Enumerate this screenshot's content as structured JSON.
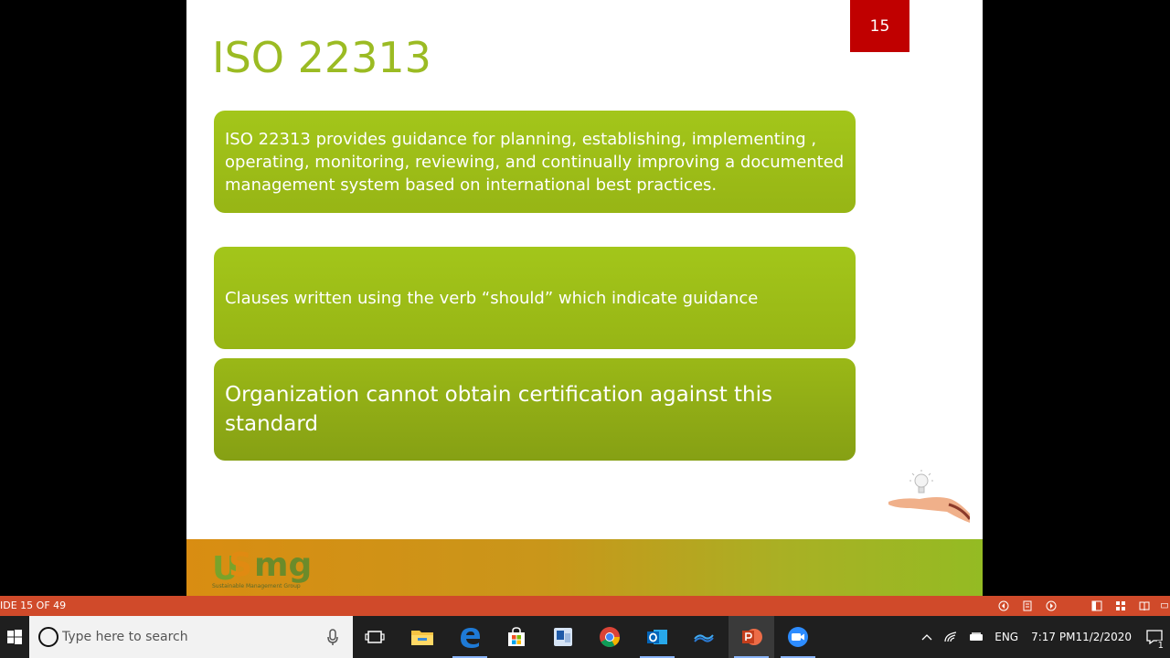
{
  "slide": {
    "title": "ISO 22313",
    "number": "15",
    "boxes": [
      "ISO 22313 provides guidance for planning, establishing, implementing , operating, monitoring, reviewing, and continually improving a documented management system based on international best practices.",
      "Clauses written using the verb “should” which indicate guidance",
      "Organization cannot obtain certification against this standard"
    ],
    "logo": {
      "text": "mg",
      "u": "U",
      "s_letter": "S",
      "subtitle": "Sustainable Management Group"
    }
  },
  "status_bar": {
    "slide_count": "IDE 15 OF 49"
  },
  "taskbar": {
    "search_placeholder": "Type here to search",
    "language": "ENG",
    "time": "7:17 PM",
    "date": "11/2/2020",
    "notification_count": "1"
  },
  "colors": {
    "accent_green": "#9bbb23",
    "slide_number_bg": "#c00000",
    "status_bar": "#d04a2a"
  }
}
